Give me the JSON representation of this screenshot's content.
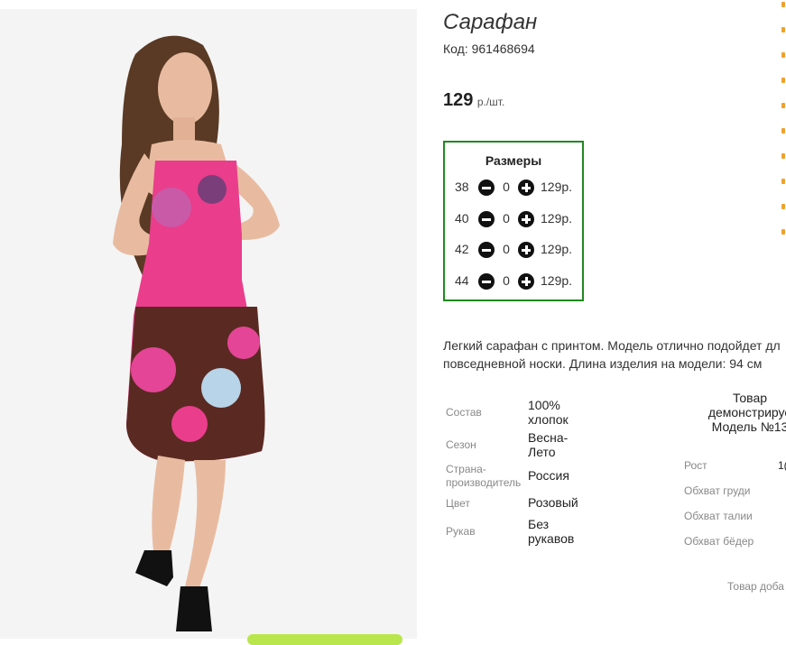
{
  "product": {
    "title": "Сарафан",
    "code": "Код: 961468694",
    "price_value": "129",
    "price_unit": "р./шт."
  },
  "sizes": {
    "title": "Размеры",
    "rows": [
      {
        "size": "38",
        "qty": "0",
        "price": "129р."
      },
      {
        "size": "40",
        "qty": "0",
        "price": "129р."
      },
      {
        "size": "42",
        "qty": "0",
        "price": "129р."
      },
      {
        "size": "44",
        "qty": "0",
        "price": "129р."
      }
    ]
  },
  "description": {
    "line1": "Легкий сарафан с принтом. Модель отлично подойдет дл",
    "line2": "повседневной носки. Длина изделия на модели: 94 см"
  },
  "properties": [
    {
      "label": "Состав",
      "value": "100% хлопок"
    },
    {
      "label": "Сезон",
      "value": "Весна-Лето"
    },
    {
      "label": "Страна-производитель",
      "value": "Россия"
    },
    {
      "label": "Цвет",
      "value": "Розовый"
    },
    {
      "label": "Рукав",
      "value": "Без рукавов"
    }
  ],
  "model": {
    "header_line1": "Товар",
    "header_line2": "демонстрируе",
    "header_line3": "Модель №13",
    "rows": [
      {
        "label": "Рост",
        "value": "1("
      },
      {
        "label": "Обхват груди",
        "value": ""
      },
      {
        "label": "Обхват талии",
        "value": ""
      },
      {
        "label": "Обхват бёдер",
        "value": ""
      }
    ]
  },
  "footer": {
    "added_text": "Товар доба"
  },
  "colors": {
    "accent_border": "#1f8a1f",
    "edge_accent": "#f0a22a",
    "button_green": "#b9e64c"
  }
}
